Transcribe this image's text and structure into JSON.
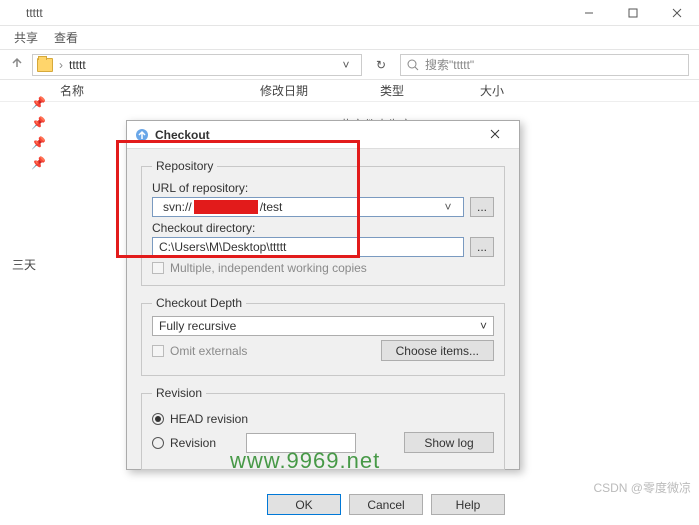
{
  "titlebar": {
    "title": "ttttt"
  },
  "ribbon": {
    "share": "共享",
    "view": "查看"
  },
  "address": {
    "sep": "›",
    "folder": "ttttt",
    "chev": "˅",
    "refresh": "↻"
  },
  "search": {
    "placeholder": "搜索\"ttttt\""
  },
  "columns": {
    "name": "名称",
    "date": "修改日期",
    "type": "类型",
    "size": "大小"
  },
  "empty": "此文件夹为空。",
  "nav": {
    "days": "三天"
  },
  "dialog": {
    "title": "Checkout",
    "repo": {
      "legend": "Repository",
      "url_label": "URL of repository:",
      "url_prefix": "svn://",
      "url_suffix": "/test",
      "dir_label": "Checkout directory:",
      "dir_value": "C:\\Users\\M\\Desktop\\ttttt",
      "multi": "Multiple, independent working copies"
    },
    "depth": {
      "legend": "Checkout Depth",
      "value": "Fully recursive",
      "omit": "Omit externals",
      "choose": "Choose items..."
    },
    "rev": {
      "legend": "Revision",
      "head": "HEAD revision",
      "revision": "Revision",
      "showlog": "Show log"
    },
    "buttons": {
      "ok": "OK",
      "cancel": "Cancel",
      "help": "Help"
    }
  },
  "watermark": "www.9969.net",
  "credit": "CSDN @零度微凉"
}
